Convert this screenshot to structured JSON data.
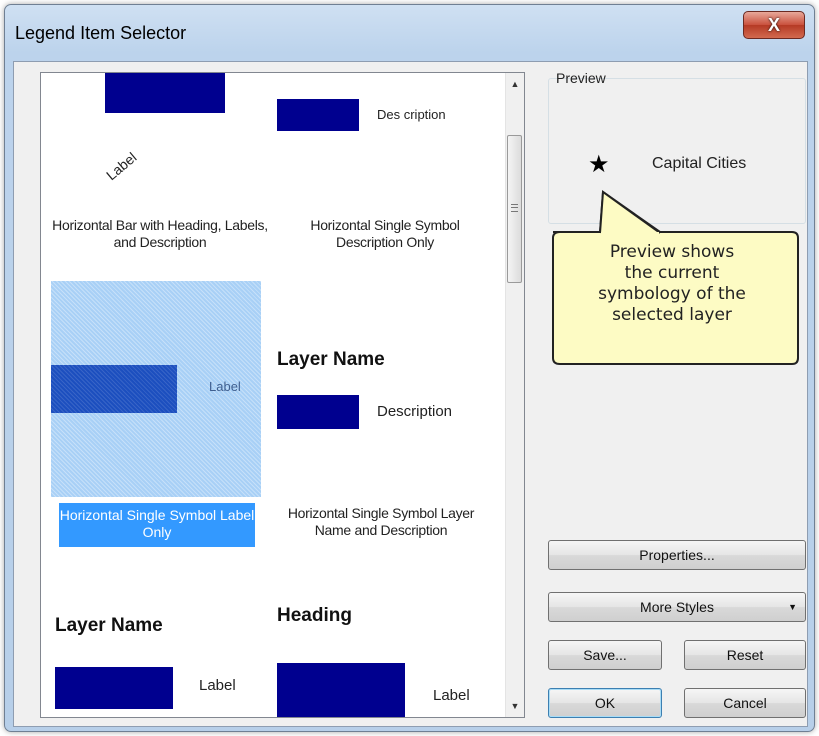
{
  "window": {
    "title": "Legend Item Selector",
    "close_glyph": "X"
  },
  "gallery": {
    "items": [
      {
        "sample_label": "Label",
        "description": "",
        "caption": "Horizontal Bar with Heading, Labels, and Description"
      },
      {
        "sample_label": "",
        "description": "Des cription",
        "caption": "Horizontal Single Symbol Description Only"
      },
      {
        "sample_label": "Label",
        "description": "",
        "caption": "Horizontal Single Symbol Label Only",
        "selected": true
      },
      {
        "layer_name": "Layer Name",
        "description": "Description",
        "caption": "Horizontal Single Symbol Layer Name and Description"
      },
      {
        "layer_name": "Layer Name",
        "sample_label": "Label"
      },
      {
        "heading": "Heading",
        "sample_label": "Label"
      }
    ]
  },
  "preview": {
    "label": "Preview",
    "symbol": "star-icon",
    "layer_label": "Capital Cities"
  },
  "callout": {
    "lines": [
      "Preview shows",
      "the current",
      "symbology of the",
      "selected layer"
    ]
  },
  "buttons": {
    "properties": "Properties...",
    "more_styles": "More Styles",
    "save": "Save...",
    "reset": "Reset",
    "ok": "OK",
    "cancel": "Cancel"
  },
  "colors": {
    "symbol_fill": "#00008f",
    "selection": "#3399ff",
    "callout_fill": "#fdfbc4"
  }
}
